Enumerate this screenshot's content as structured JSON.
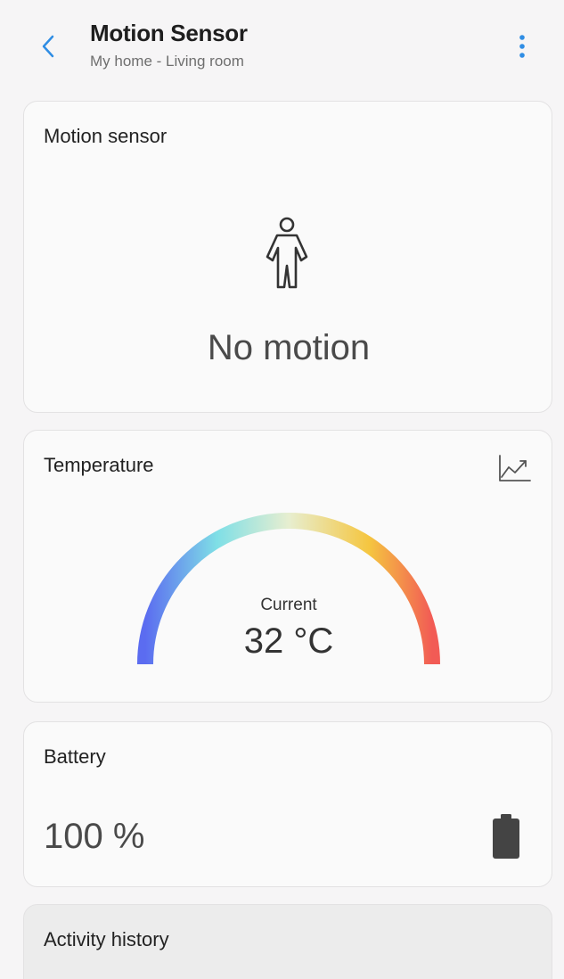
{
  "header": {
    "title": "Motion Sensor",
    "subtitle": "My home - Living room",
    "back_icon": "chevron-left-icon",
    "more_icon": "more-vertical-icon"
  },
  "motion_card": {
    "title": "Motion sensor",
    "icon": "person-icon",
    "status": "No motion"
  },
  "temperature_card": {
    "title": "Temperature",
    "history_icon": "line-chart-icon",
    "gauge_label": "Current",
    "value_text": "32 °C",
    "gauge_colors": [
      "#5b6cf0",
      "#7fdfe6",
      "#e7eed0",
      "#f5c640",
      "#f25b55"
    ]
  },
  "battery_card": {
    "title": "Battery",
    "value_text": "100 %",
    "level_percent": 100,
    "icon": "battery-full-icon"
  },
  "history_card": {
    "title": "Activity history"
  },
  "colors": {
    "accent": "#2f8de4",
    "background": "#f6f5f6",
    "card": "#fafafa"
  }
}
